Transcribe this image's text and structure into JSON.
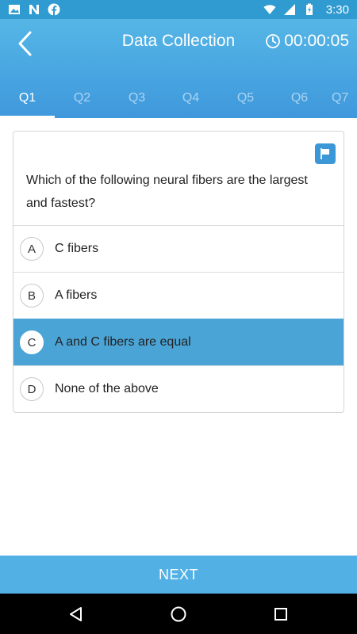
{
  "status_bar": {
    "time": "3:30",
    "icons_left": [
      "image-icon",
      "n-notification-icon",
      "facebook-icon"
    ],
    "icons_right": [
      "wifi-icon",
      "signal-icon",
      "battery-charging-icon"
    ]
  },
  "header": {
    "title": "Data Collection",
    "timer": "00:00:05",
    "back_icon": "chevron-left-icon",
    "timer_icon": "clock-icon"
  },
  "tabs": [
    {
      "label": "Q1",
      "active": true
    },
    {
      "label": "Q2",
      "active": false
    },
    {
      "label": "Q3",
      "active": false
    },
    {
      "label": "Q4",
      "active": false
    },
    {
      "label": "Q5",
      "active": false
    },
    {
      "label": "Q6",
      "active": false
    },
    {
      "label": "Q7",
      "active": false
    }
  ],
  "question": {
    "text": "Which of the following neural fibers are the largest and fastest?",
    "flag_icon": "flag-icon",
    "options": [
      {
        "letter": "A",
        "text": "C fibers",
        "selected": false
      },
      {
        "letter": "B",
        "text": "A fibers",
        "selected": false
      },
      {
        "letter": "C",
        "text": "A and C fibers are equal",
        "selected": true
      },
      {
        "letter": "D",
        "text": "None of the above",
        "selected": false
      }
    ]
  },
  "next_button": {
    "label": "NEXT"
  },
  "colors": {
    "header_top": "#55b6e6",
    "header_bottom": "#3f98dc",
    "selected_option": "#4ba4d6",
    "next_button": "#52b0e5"
  }
}
